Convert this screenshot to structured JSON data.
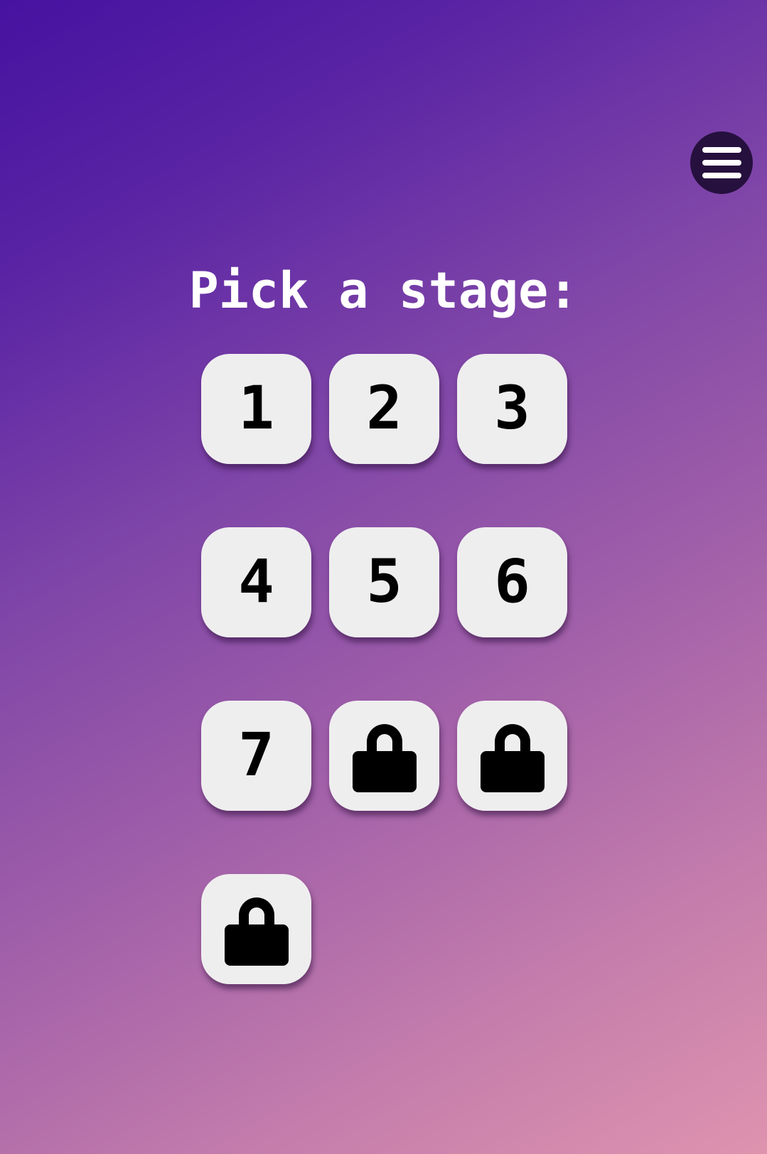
{
  "menu": {
    "icon": "hamburger-menu-icon",
    "colors": {
      "background": "#26103e",
      "bars": "#ffffff"
    }
  },
  "title": "Pick a stage:",
  "stages": [
    {
      "label": "1",
      "locked": false
    },
    {
      "label": "2",
      "locked": false
    },
    {
      "label": "3",
      "locked": false
    },
    {
      "label": "4",
      "locked": false
    },
    {
      "label": "5",
      "locked": false
    },
    {
      "label": "6",
      "locked": false
    },
    {
      "label": "7",
      "locked": false
    },
    {
      "label": "",
      "locked": true,
      "icon": "lock-icon"
    },
    {
      "label": "",
      "locked": true,
      "icon": "lock-icon"
    },
    {
      "label": "",
      "locked": true,
      "icon": "lock-icon"
    }
  ],
  "colors": {
    "gradient_start": "#4612a0",
    "gradient_end": "#de93ae",
    "tile_background": "#efeeef",
    "tile_text": "#000000",
    "title_text": "#ffffff"
  }
}
